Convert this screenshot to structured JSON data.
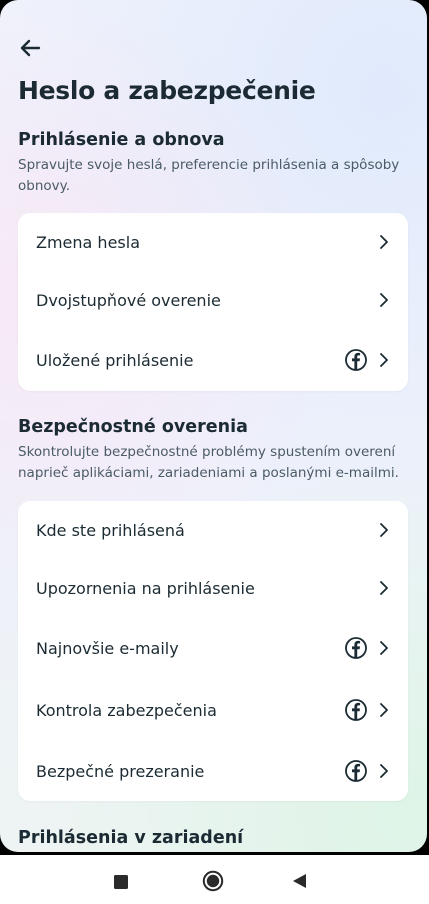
{
  "header": {
    "back_icon": "arrow-left-icon",
    "title": "Heslo a zabezpečenie"
  },
  "sections": [
    {
      "title": "Prihlásenie a obnova",
      "description": "Spravujte svoje heslá, preferencie prihlásenia a spôsoby obnovy.",
      "items": [
        {
          "label": "Zmena hesla",
          "facebook_icon": false
        },
        {
          "label": "Dvojstupňové overenie",
          "facebook_icon": false
        },
        {
          "label": "Uložené prihlásenie",
          "facebook_icon": true
        }
      ]
    },
    {
      "title": "Bezpečnostné overenia",
      "description": "Skontrolujte bezpečnostné problémy spustením overení naprieč aplikáciami, zariadeniami a poslanými e-mailmi.",
      "items": [
        {
          "label": "Kde ste prihlásená",
          "facebook_icon": false
        },
        {
          "label": "Upozornenia na prihlásenie",
          "facebook_icon": false
        },
        {
          "label": "Najnovšie e-maily",
          "facebook_icon": true
        },
        {
          "label": "Kontrola zabezpečenia",
          "facebook_icon": true
        },
        {
          "label": "Bezpečné prezeranie",
          "facebook_icon": true
        }
      ]
    },
    {
      "title": "Prihlásenia v zariadení"
    }
  ],
  "system_nav": {
    "recents_icon": "square-icon",
    "home_icon": "circle-icon",
    "back_icon": "triangle-back-icon"
  },
  "colors": {
    "text_primary": "#1c2b33",
    "text_secondary": "#4b5b66",
    "card_background": "#ffffff",
    "icon": "#1c2b33"
  }
}
